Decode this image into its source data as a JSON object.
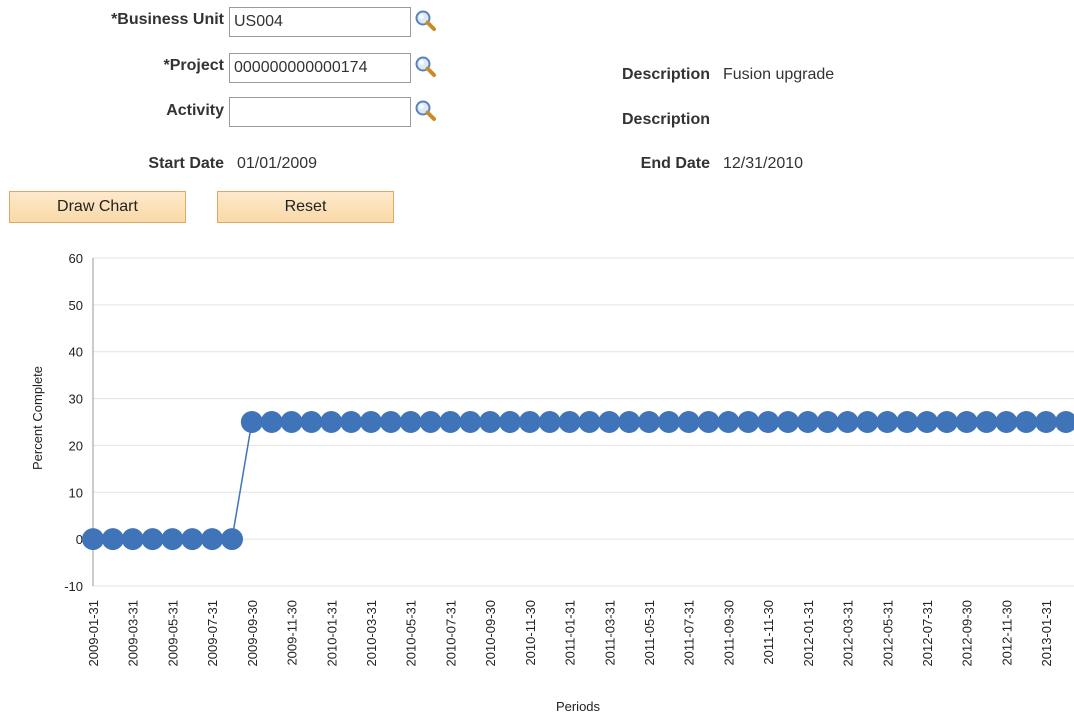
{
  "form": {
    "business_unit": {
      "label": "*Business Unit",
      "value": "US004"
    },
    "project": {
      "label": "*Project",
      "value": "000000000000174"
    },
    "activity": {
      "label": "Activity",
      "value": ""
    },
    "description1": {
      "label": "Description",
      "value": "Fusion upgrade"
    },
    "description2": {
      "label": "Description",
      "value": ""
    },
    "start_date": {
      "label": "Start Date",
      "value": "01/01/2009"
    },
    "end_date": {
      "label": "End Date",
      "value": "12/31/2010"
    }
  },
  "buttons": {
    "draw_chart": "Draw Chart",
    "reset": "Reset"
  },
  "icons": {
    "lookup": "magnifier-icon"
  },
  "colors": {
    "series": "#3f74b8",
    "button_bg": "#fbe0b6",
    "button_border": "#e0a860"
  },
  "chart_data": {
    "type": "line",
    "xlabel": "Periods",
    "ylabel": "Percent Complete",
    "ylim": [
      -10,
      60
    ],
    "yticks": [
      -10,
      0,
      10,
      20,
      30,
      40,
      50,
      60
    ],
    "grid": true,
    "x_tick_labels": [
      "2009-01-31",
      "2009-03-31",
      "2009-05-31",
      "2009-07-31",
      "2009-09-30",
      "2009-11-30",
      "2010-01-31",
      "2010-03-31",
      "2010-05-31",
      "2010-07-31",
      "2010-09-30",
      "2010-11-30",
      "2011-01-31",
      "2011-03-31",
      "2011-05-31",
      "2011-07-31",
      "2011-09-30",
      "2011-11-30",
      "2012-01-31",
      "2012-03-31",
      "2012-05-31",
      "2012-07-31",
      "2012-09-30",
      "2012-11-30",
      "2013-01-31"
    ],
    "x": [
      "2009-01-31",
      "2009-02-28",
      "2009-03-31",
      "2009-04-30",
      "2009-05-31",
      "2009-06-30",
      "2009-07-31",
      "2009-08-31",
      "2009-09-30",
      "2009-10-31",
      "2009-11-30",
      "2009-12-31",
      "2010-01-31",
      "2010-02-28",
      "2010-03-31",
      "2010-04-30",
      "2010-05-31",
      "2010-06-30",
      "2010-07-31",
      "2010-08-31",
      "2010-09-30",
      "2010-10-31",
      "2010-11-30",
      "2010-12-31",
      "2011-01-31",
      "2011-02-28",
      "2011-03-31",
      "2011-04-30",
      "2011-05-31",
      "2011-06-30",
      "2011-07-31",
      "2011-08-31",
      "2011-09-30",
      "2011-10-31",
      "2011-11-30",
      "2011-12-31",
      "2012-01-31",
      "2012-02-29",
      "2012-03-31",
      "2012-04-30",
      "2012-05-31",
      "2012-06-30",
      "2012-07-31",
      "2012-08-31",
      "2012-09-30",
      "2012-10-31",
      "2012-11-30",
      "2012-12-31",
      "2013-01-31",
      "2013-02-28"
    ],
    "values": [
      0,
      0,
      0,
      0,
      0,
      0,
      0,
      0,
      25,
      25,
      25,
      25,
      25,
      25,
      25,
      25,
      25,
      25,
      25,
      25,
      25,
      25,
      25,
      25,
      25,
      25,
      25,
      25,
      25,
      25,
      25,
      25,
      25,
      25,
      25,
      25,
      25,
      25,
      25,
      25,
      25,
      25,
      25,
      25,
      25,
      25,
      25,
      25,
      25,
      25
    ]
  }
}
